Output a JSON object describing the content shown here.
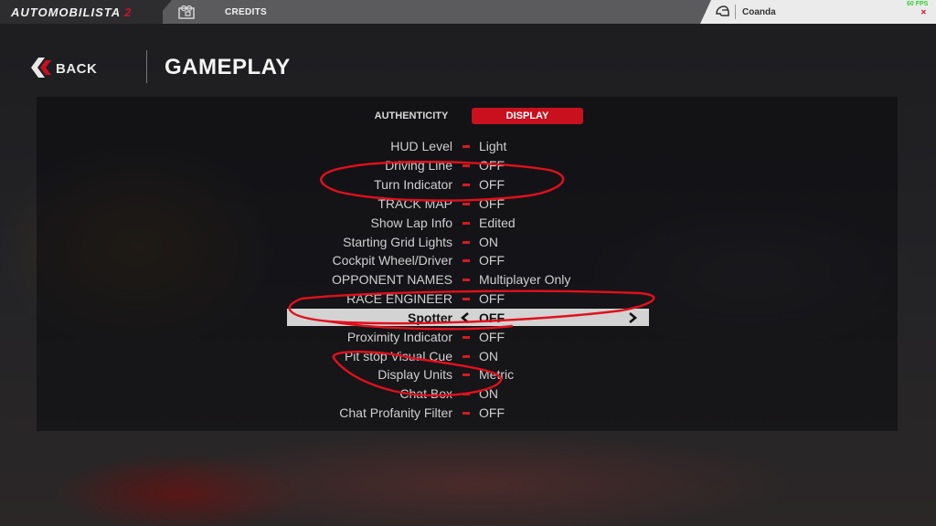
{
  "topbar": {
    "logo_main": "AUTOMOBILISTA",
    "logo_num": "2",
    "credits": "CREDITS",
    "username": "Coanda",
    "fps": "60 FPS"
  },
  "header": {
    "back_label": "BACK",
    "title": "GAMEPLAY"
  },
  "tabs": [
    {
      "label": "AUTHENTICITY",
      "active": false
    },
    {
      "label": "DISPLAY",
      "active": true
    }
  ],
  "settings": [
    {
      "label": "HUD Level",
      "value": "Light"
    },
    {
      "label": "Driving Line",
      "value": "OFF"
    },
    {
      "label": "Turn Indicator",
      "value": "OFF"
    },
    {
      "label": "TRACK MAP",
      "value": "OFF"
    },
    {
      "label": "Show Lap Info",
      "value": "Edited"
    },
    {
      "label": "Starting Grid Lights",
      "value": "ON"
    },
    {
      "label": "Cockpit Wheel/Driver",
      "value": "OFF"
    },
    {
      "label": "OPPONENT NAMES",
      "value": "Multiplayer Only"
    },
    {
      "label": "RACE ENGINEER",
      "value": "OFF"
    },
    {
      "label": "Spotter",
      "value": "OFF",
      "selected": true
    },
    {
      "label": "Proximity Indicator",
      "value": "OFF"
    },
    {
      "label": "Pit stop Visual Cue",
      "value": "ON"
    },
    {
      "label": "Display Units",
      "value": "Metric"
    },
    {
      "label": "Chat Box",
      "value": "ON"
    },
    {
      "label": "Chat Profanity Filter",
      "value": "OFF"
    }
  ],
  "colors": {
    "accent_red": "#c8101e",
    "annotation_red": "#e0101c",
    "selected_row": "#d3d3d3"
  }
}
